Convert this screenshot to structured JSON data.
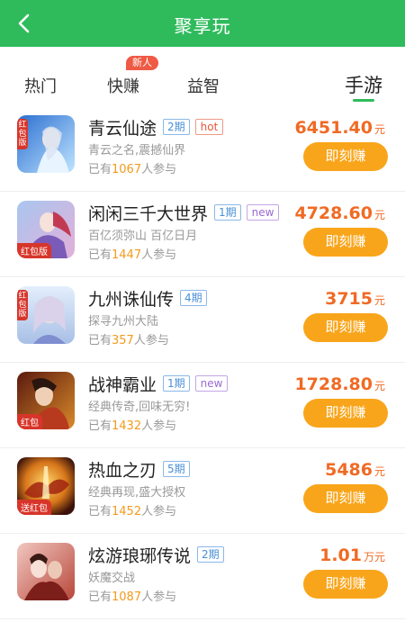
{
  "header": {
    "title": "聚享玩",
    "back_icon": "chevron-left-icon"
  },
  "colors": {
    "brand": "#2fbb5c",
    "button": "#f9a51b",
    "price": "#f06a24",
    "badge": "#ef5a45"
  },
  "tabs": [
    {
      "label": "热门"
    },
    {
      "label": "快赚",
      "badge": "新人"
    },
    {
      "label": "益智"
    },
    {
      "label": "手游",
      "active": true
    }
  ],
  "games": [
    {
      "name": "青云仙途",
      "period": "2期",
      "flag": "hot",
      "desc": "青云之名,震撼仙界",
      "joined_prefix": "已有",
      "joined_count": "1067",
      "joined_suffix": "人参与",
      "amount": "6451.40",
      "unit": "元",
      "button": "即刻赚",
      "icon_tag": "红包版",
      "icon": "qingyun-game-icon"
    },
    {
      "name": "闲闲三千大世界",
      "period": "1期",
      "flag": "new",
      "desc": "百亿须弥山 百亿日月",
      "joined_prefix": "已有",
      "joined_count": "1447",
      "joined_suffix": "人参与",
      "amount": "4728.60",
      "unit": "元",
      "button": "即刻赚",
      "icon_tag": "红包版",
      "icon": "sanqian-game-icon"
    },
    {
      "name": "九州诛仙传",
      "period": "4期",
      "flag": "",
      "desc": "探寻九州大陆",
      "joined_prefix": "已有",
      "joined_count": "357",
      "joined_suffix": "人参与",
      "amount": "3715",
      "unit": "元",
      "button": "即刻赚",
      "icon_tag": "红包版",
      "icon": "jiuzhou-game-icon"
    },
    {
      "name": "战神霸业",
      "period": "1期",
      "flag": "new",
      "desc": "经典传奇,回味无穷!",
      "joined_prefix": "已有",
      "joined_count": "1432",
      "joined_suffix": "人参与",
      "amount": "1728.80",
      "unit": "元",
      "button": "即刻赚",
      "icon_tag": "红包",
      "icon": "zhanshen-game-icon"
    },
    {
      "name": "热血之刃",
      "period": "5期",
      "flag": "",
      "desc": "经典再现,盛大授权",
      "joined_prefix": "已有",
      "joined_count": "1452",
      "joined_suffix": "人参与",
      "amount": "5486",
      "unit": "元",
      "button": "即刻赚",
      "icon_tag": "送红包",
      "icon": "rexue-game-icon"
    },
    {
      "name": "炫游琅琊传说",
      "period": "2期",
      "flag": "",
      "desc": "妖魔交战",
      "joined_prefix": "已有",
      "joined_count": "1087",
      "joined_suffix": "人参与",
      "amount": "1.01",
      "unit": "万元",
      "button": "即刻赚",
      "icon_tag": "",
      "icon": "langya-game-icon"
    }
  ]
}
